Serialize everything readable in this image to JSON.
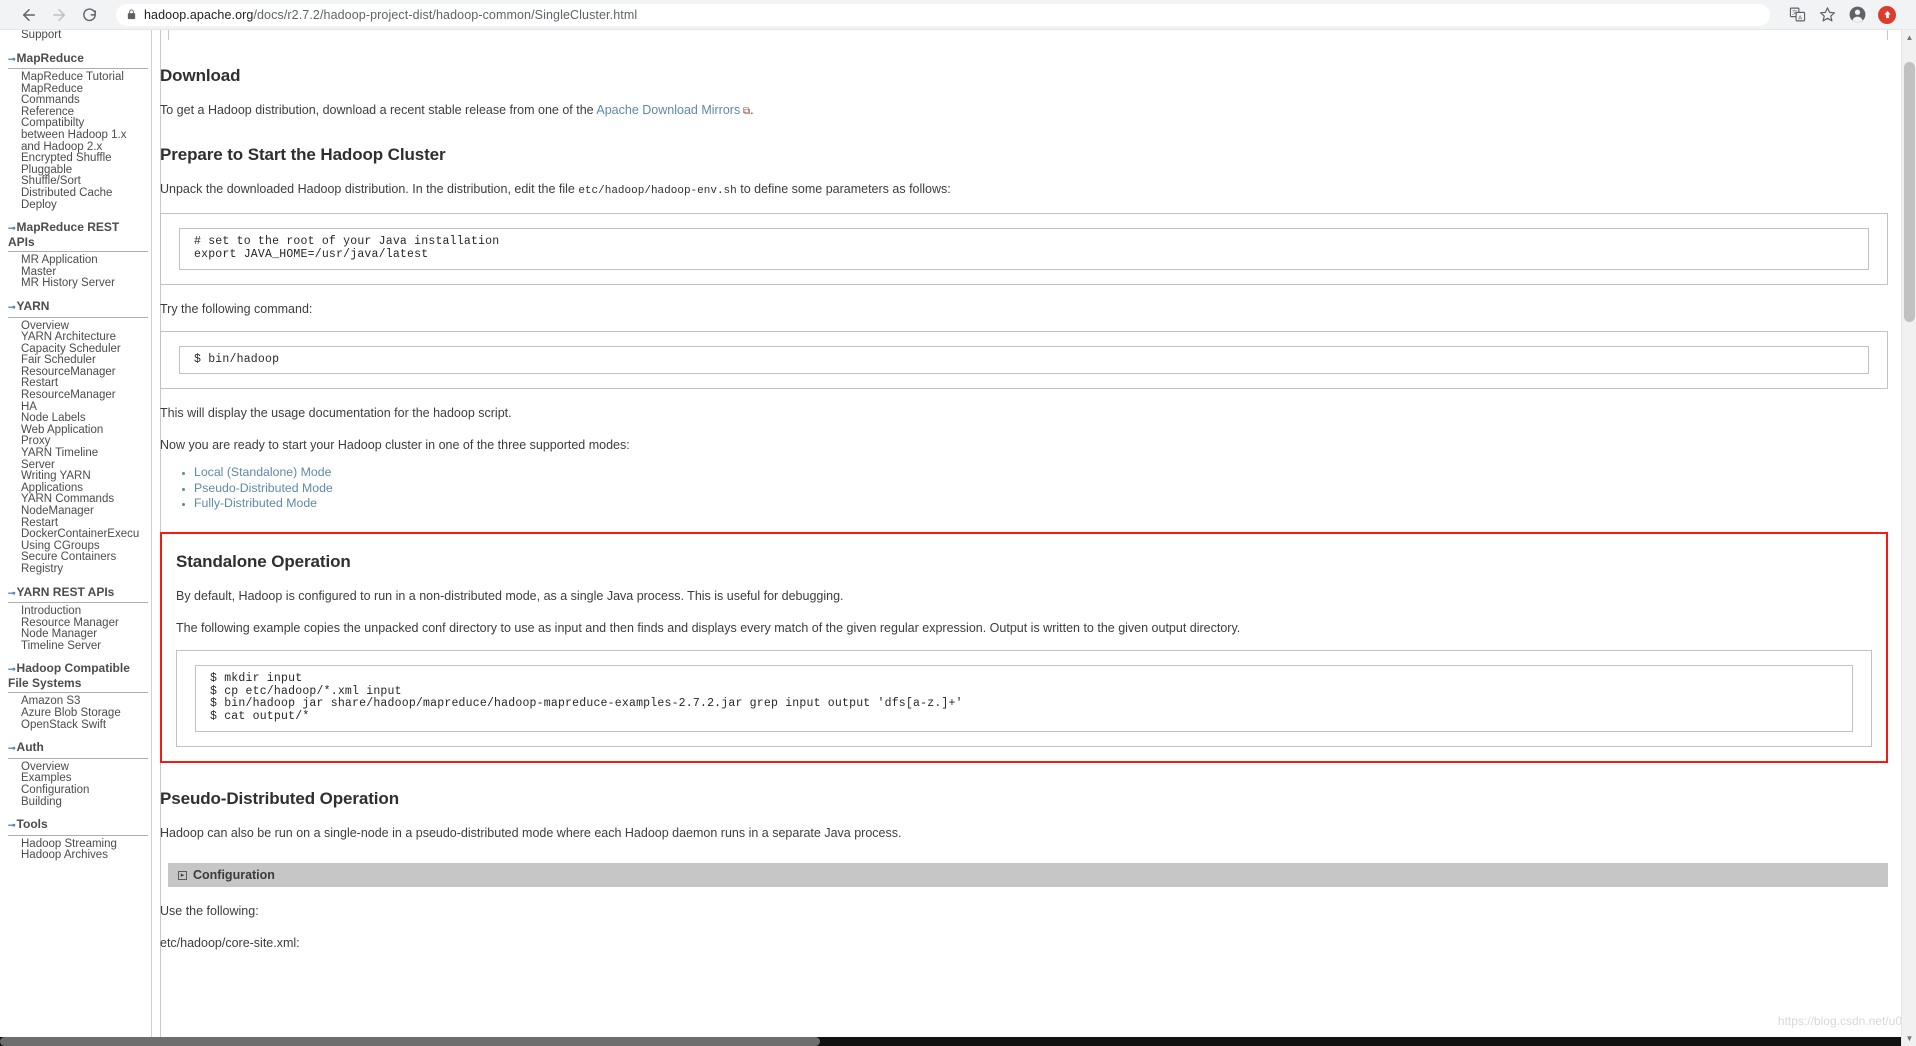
{
  "browser": {
    "back_label": "back-arrow",
    "forward_label": "forward-arrow",
    "reload_label": "reload",
    "url_secure": "hadoop.apache.org",
    "url_path": "/docs/r2.7.2/hadoop-project-dist/hadoop-common/SingleCluster.html",
    "url_full": "hadoop.apache.org/docs/r2.7.2/hadoop-project-dist/hadoop-common/SingleCluster.html",
    "translate_label": "Translate this page",
    "bookmark_label": "Bookmark this tab",
    "profile_label": "Profile",
    "update_label": "Update Chrome"
  },
  "sidebar": {
    "groups": [
      {
        "title": "",
        "has_arrow": false,
        "items": [
          "Support"
        ]
      },
      {
        "title": "MapReduce",
        "has_arrow": true,
        "items": [
          "MapReduce Tutorial",
          "MapReduce",
          "Commands",
          "Reference",
          "Compatibilty",
          "between Hadoop 1.x",
          "and Hadoop 2.x",
          "Encrypted Shuffle",
          "Pluggable",
          "Shuffle/Sort",
          "Distributed Cache",
          "Deploy"
        ]
      },
      {
        "title": "MapReduce REST APIs",
        "has_arrow": true,
        "items": [
          "MR Application",
          "Master",
          "MR History Server"
        ]
      },
      {
        "title": "YARN",
        "has_arrow": true,
        "items": [
          "Overview",
          "YARN Architecture",
          "Capacity Scheduler",
          "Fair Scheduler",
          "ResourceManager",
          "Restart",
          "ResourceManager",
          "HA",
          "Node Labels",
          "Web Application",
          "Proxy",
          "YARN Timeline",
          "Server",
          "Writing YARN",
          "Applications",
          "YARN Commands",
          "NodeManager",
          "Restart",
          "DockerContainerExecu",
          "Using CGroups",
          "Secure Containers",
          "Registry"
        ]
      },
      {
        "title": "YARN REST APIs",
        "has_arrow": true,
        "items": [
          "Introduction",
          "Resource Manager",
          "Node Manager",
          "Timeline Server"
        ]
      },
      {
        "title": "Hadoop Compatible File Systems",
        "has_arrow": true,
        "items": [
          "Amazon S3",
          "Azure Blob Storage",
          "OpenStack Swift"
        ]
      },
      {
        "title": "Auth",
        "has_arrow": true,
        "items": [
          "Overview",
          "Examples",
          "Configuration",
          "Building"
        ]
      },
      {
        "title": "Tools",
        "has_arrow": true,
        "items": [
          "Hadoop Streaming",
          "Hadoop Archives"
        ]
      }
    ]
  },
  "doc": {
    "download": {
      "heading": "Download",
      "para_before": "To get a Hadoop distribution, download a recent stable release from one of the ",
      "link_text": "Apache Download Mirrors",
      "para_after": "."
    },
    "prepare": {
      "heading": "Prepare to Start the Hadoop Cluster",
      "para_a": "Unpack the downloaded Hadoop distribution. In the distribution, edit the file ",
      "para_code": "etc/hadoop/hadoop-env.sh",
      "para_b": " to define some parameters as follows:",
      "code_env": "# set to the root of your Java installation\nexport JAVA_HOME=/usr/java/latest",
      "para_try": "Try the following command:",
      "code_try": "$ bin/hadoop",
      "para_usage": "This will display the usage documentation for the hadoop script.",
      "para_modes": "Now you are ready to start your Hadoop cluster in one of the three supported modes:",
      "modes": [
        "Local (Standalone) Mode",
        "Pseudo-Distributed Mode",
        "Fully-Distributed Mode"
      ]
    },
    "standalone": {
      "heading": "Standalone Operation",
      "para_1": "By default, Hadoop is configured to run in a non-distributed mode, as a single Java process. This is useful for debugging.",
      "para_2": "The following example copies the unpacked conf directory to use as input and then finds and displays every match of the given regular expression. Output is written to the given output directory.",
      "code": "$ mkdir input\n$ cp etc/hadoop/*.xml input\n$ bin/hadoop jar share/hadoop/mapreduce/hadoop-mapreduce-examples-2.7.2.jar grep input output 'dfs[a-z.]+'\n$ cat output/*",
      "highlight_color": "#f41c12"
    },
    "pseudo": {
      "heading": "Pseudo-Distributed Operation",
      "para_1": "Hadoop can also be run on a single-node in a pseudo-distributed mode where each Hadoop daemon runs in a separate Java process.",
      "config_label": "Configuration",
      "para_use": "Use the following:",
      "file_label": "etc/hadoop/core-site.xml:"
    }
  },
  "watermark": "https://blog.csdn.net/u0"
}
